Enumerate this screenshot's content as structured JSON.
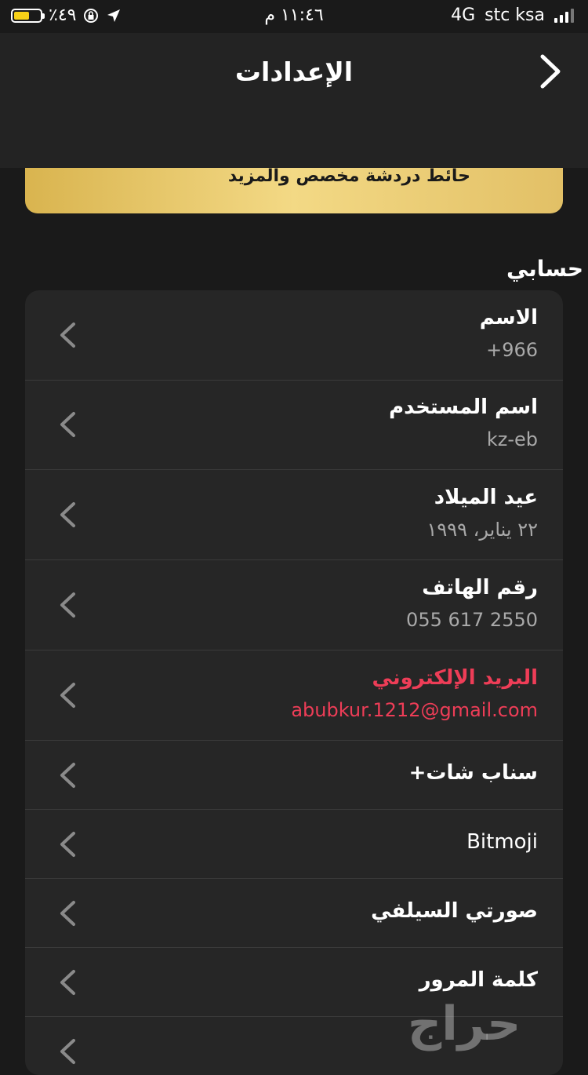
{
  "status_bar": {
    "battery_percent": "٪٤٩",
    "time": "١١:٤٦ م",
    "network": "4G",
    "carrier": "stc ksa"
  },
  "header": {
    "title": "الإعدادات"
  },
  "promo": {
    "text": "حائط دردشة مخصص والمزيد"
  },
  "section": {
    "title": "حسابي"
  },
  "rows": [
    {
      "label": "الاسم",
      "value": "+966"
    },
    {
      "label": "اسم المستخدم",
      "value": "kz-eb"
    },
    {
      "label": "عيد الميلاد",
      "value": "٢٢ يناير، ١٩٩٩"
    },
    {
      "label": "رقم الهاتف",
      "value": "055 617 2550"
    },
    {
      "label": "البريد الإلكتروني",
      "value": "abubkur.1212@gmail.com"
    },
    {
      "label": "سناب شات+"
    },
    {
      "label": "Bitmoji"
    },
    {
      "label": "صورتي السيلفي"
    },
    {
      "label": "كلمة المرور"
    }
  ],
  "watermark": "حراج",
  "colors": {
    "accent_red": "#ee3d57",
    "promo_gold": "#f3d985",
    "background": "#1a1a1a"
  }
}
